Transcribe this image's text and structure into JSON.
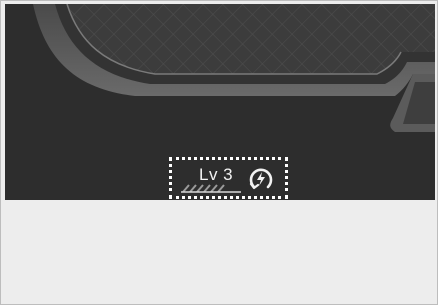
{
  "image": {
    "description_free": true
  },
  "indicator": {
    "level_text": "Lv 3",
    "level": 3,
    "icon_bars": "segmented-level-bar-icon",
    "icon_charge": "charging-lightning-icon"
  },
  "colors": {
    "panel_dark": "#2d2d2d",
    "seat_dark": "#3a3a3a",
    "seat_light": "#5a5a5a",
    "text_light": "#f2f2f2",
    "background_light": "#ededed"
  }
}
